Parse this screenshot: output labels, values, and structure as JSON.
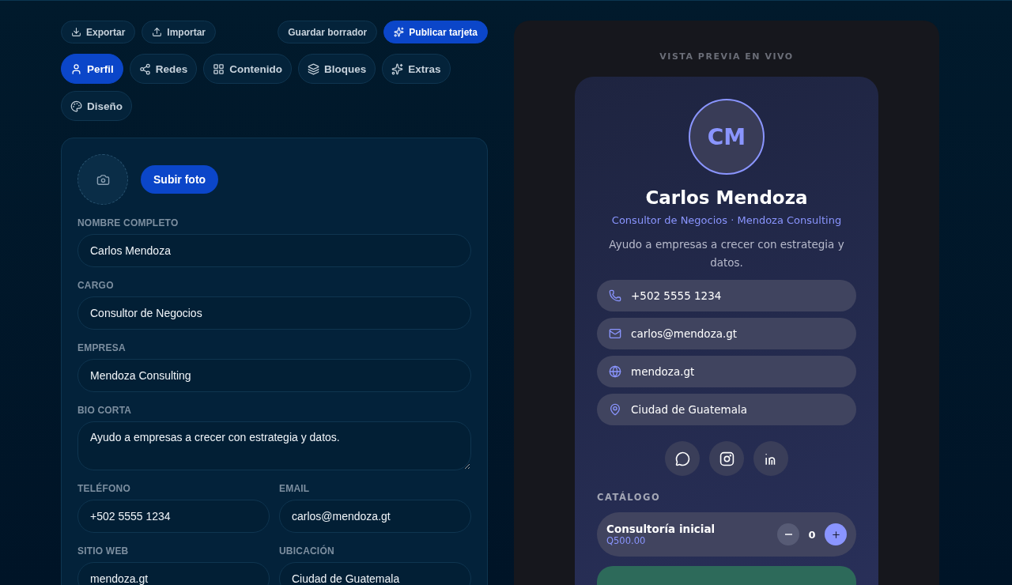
{
  "toolbar": {
    "left_buttons": [
      {
        "label": "Exportar",
        "kind": "download"
      },
      {
        "label": "Importar",
        "kind": "upload"
      }
    ],
    "right_buttons": [
      {
        "label": "Guardar borrador",
        "kind": "secondary"
      },
      {
        "label": "Publicar tarjeta",
        "kind": "primary"
      }
    ]
  },
  "tabs": [
    {
      "label": "Perfil",
      "kind": "user",
      "selected": true
    },
    {
      "label": "Redes",
      "kind": "share",
      "selected": false
    },
    {
      "label": "Contenido",
      "kind": "grid",
      "selected": false
    },
    {
      "label": "Bloques",
      "kind": "layers",
      "selected": false
    },
    {
      "label": "Extras",
      "kind": "sparkles",
      "selected": false
    },
    {
      "label": "Diseño",
      "kind": "palette",
      "selected": false
    }
  ],
  "form": {
    "photo_button": "Subir foto",
    "fields": [
      {
        "label": "NOMBRE COMPLETO",
        "value": "Carlos Mendoza",
        "kind": "full"
      },
      {
        "label": "CARGO",
        "value": "Consultor de Negocios",
        "kind": "full"
      },
      {
        "label": "EMPRESA",
        "value": "Mendoza Consulting",
        "kind": "full"
      },
      {
        "label": "BIO CORTA",
        "value": "Ayudo a empresas a crecer con estrategia y datos.",
        "kind": "textarea"
      },
      {
        "label": "TELÉFONO",
        "value": "+502 5555 1234",
        "kind": "half"
      },
      {
        "label": "EMAIL",
        "value": "carlos@mendoza.gt",
        "kind": "half"
      },
      {
        "label": "SITIO WEB",
        "value": "mendoza.gt",
        "kind": "half"
      },
      {
        "label": "UBICACIÓN",
        "value": "Ciudad de Guatemala",
        "kind": "half"
      }
    ]
  },
  "preview": {
    "heading": "VISTA PREVIA EN VIVO",
    "initials": "CM",
    "name": "Carlos Mendoza",
    "subtitle": "Consultor de Negocios · Mendoza Consulting",
    "bio": "Ayudo a empresas a crecer con estrategia y datos.",
    "contacts": [
      {
        "kind": "phone",
        "text": "+502 5555 1234"
      },
      {
        "kind": "mail",
        "text": "carlos@mendoza.gt"
      },
      {
        "kind": "globe",
        "text": "mendoza.gt"
      },
      {
        "kind": "pin",
        "text": "Ciudad de Guatemala"
      }
    ],
    "socials": [
      {
        "kind": "chat"
      },
      {
        "kind": "instagram"
      },
      {
        "kind": "linkedin"
      }
    ],
    "catalog": {
      "heading": "CATÁLOGO",
      "items": [
        {
          "name": "Consultoría inicial",
          "price": "Q500.00",
          "quantity": "0"
        }
      ]
    }
  }
}
